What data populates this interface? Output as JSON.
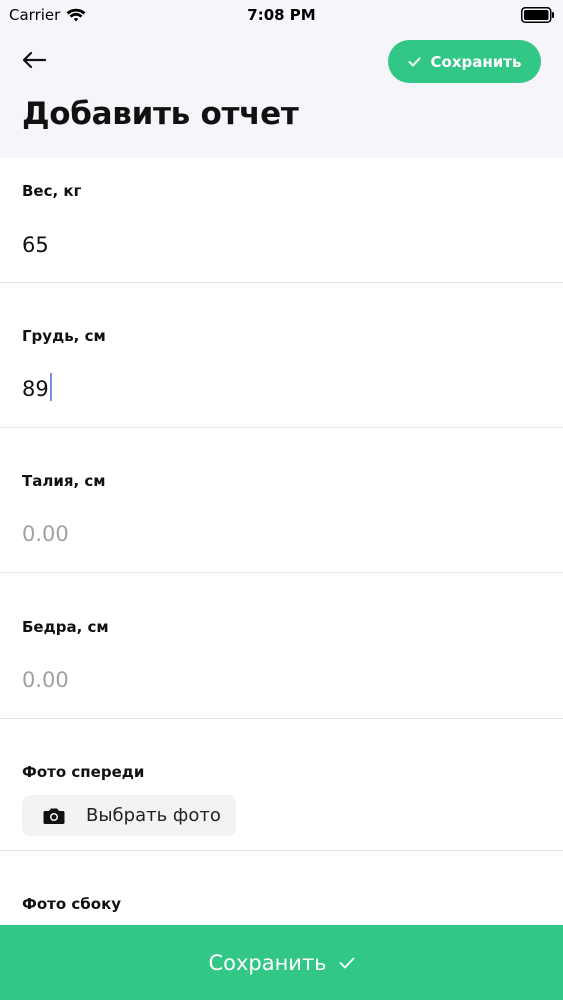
{
  "status_bar": {
    "carrier": "Carrier",
    "time": "7:08 PM"
  },
  "header": {
    "save_label": "Сохранить",
    "title": "Добавить отчет"
  },
  "fields": [
    {
      "label": "Вес, кг",
      "value": "65",
      "placeholder": ""
    },
    {
      "label": "Грудь, см",
      "value": "89",
      "placeholder": ""
    },
    {
      "label": "Талия, см",
      "value": "",
      "placeholder": "0.00"
    },
    {
      "label": "Бедра, см",
      "value": "",
      "placeholder": "0.00"
    }
  ],
  "photos": [
    {
      "label": "Фото спереди",
      "button_label": "Выбрать фото"
    },
    {
      "label": "Фото сбоку"
    }
  ],
  "footer": {
    "save_label": "Сохранить"
  },
  "colors": {
    "accent": "#33c787",
    "header_bg": "#f6f6fa",
    "placeholder": "#a0a0a6"
  },
  "icons": [
    "wifi-icon",
    "battery-icon",
    "back-arrow-icon",
    "check-icon",
    "camera-icon"
  ]
}
